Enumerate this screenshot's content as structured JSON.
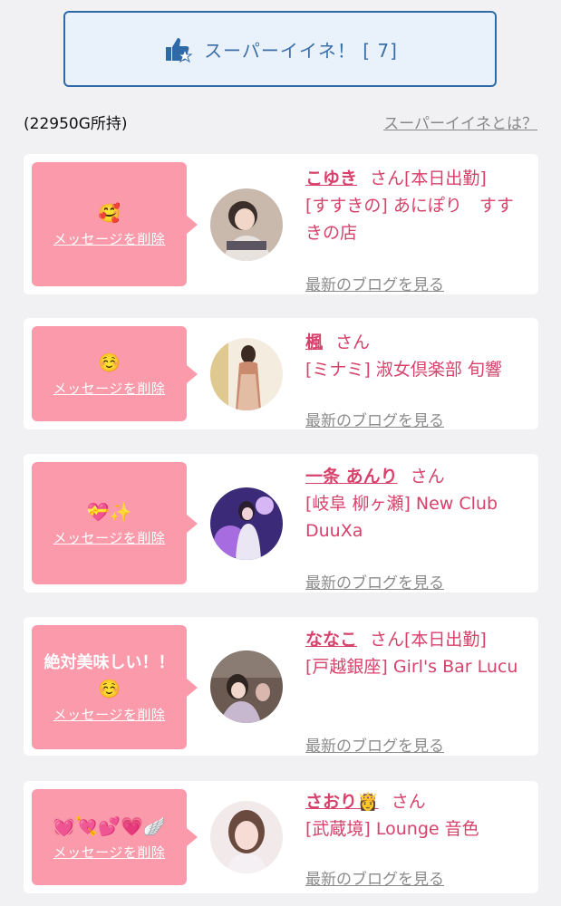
{
  "super_button": {
    "label": "スーパーイイネ！ [ 7]"
  },
  "owned_points": "(22950G所持)",
  "about_link": "スーパーイイネとは？",
  "cards": [
    {
      "message": "",
      "emoji": "🥰",
      "delete_label": "メッセージを削除",
      "name": "こゆき",
      "suffix": "さん[本日出勤]",
      "shop": "[すすきの] あにぽり　すすきの店",
      "blog_link": "最新のブログを見る"
    },
    {
      "message": "",
      "emoji": "☺️",
      "delete_label": "メッセージを削除",
      "name": "楓",
      "suffix": "さん",
      "shop": "[ミナミ] 淑女倶楽部 旬響",
      "blog_link": "最新のブログを見る"
    },
    {
      "message": "",
      "emoji": "💝✨",
      "delete_label": "メッセージを削除",
      "name": "一条 あんり",
      "suffix": "さん",
      "shop": "[岐阜 柳ヶ瀬] New Club DuuXa",
      "blog_link": "最新のブログを見る"
    },
    {
      "message": "絶対美味しい！！",
      "emoji": "☺️",
      "delete_label": "メッセージを削除",
      "name": "ななこ",
      "suffix": "さん[本日出勤]",
      "shop": "[戸越銀座] Girl's Bar Lucu",
      "blog_link": "最新のブログを見る"
    },
    {
      "message": "",
      "emoji": "💓💘💕💗🪽",
      "delete_label": "メッセージを削除",
      "name": "さおり👸",
      "suffix": "さん",
      "shop": "[武蔵境] Lounge 音色",
      "blog_link": "最新のブログを見る"
    }
  ],
  "colors": {
    "accent_pink": "#d6426b",
    "bubble_pink": "#fb9aaa",
    "button_blue": "#2f6aa8"
  }
}
